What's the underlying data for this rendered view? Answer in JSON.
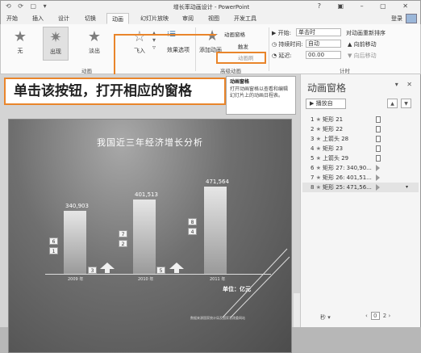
{
  "window": {
    "title": "增长率动画设计 - PowerPoint",
    "qat": "⟲ ⟳ ▢ ▾",
    "controls": "? ▣ – ▢ ✕"
  },
  "tabs": [
    "开始",
    "插入",
    "设计",
    "切换",
    "动画",
    "幻灯片放映",
    "审阅",
    "视图",
    "开发工具"
  ],
  "active_tab": "动画",
  "login": "登录",
  "ribbon": {
    "effects": [
      "无",
      "出现",
      "淡出",
      "飞入"
    ],
    "effect_options": "效果选项",
    "group_animation": "动画",
    "add_animation": "添加动画",
    "animation_pane": "动画窗格",
    "trigger": "触发",
    "animation_painter": "动画刷",
    "group_advanced": "高级动画",
    "start_label": "▶ 开始:",
    "start_value": "单击时",
    "duration_label": "◷ 持续时间:",
    "duration_value": "自动",
    "delay_label": "◔ 延迟:",
    "delay_value": "00.00",
    "reorder_title": "对动画重新排序",
    "move_earlier": "▲ 向前移动",
    "move_later": "▼ 向后移动",
    "group_timing": "计时"
  },
  "callout": "单击该按钮，打开相应的窗格",
  "tooltip": {
    "title": "动画窗格",
    "body": "打开动画窗格以查看和编辑幻灯片上的动画日程表。"
  },
  "slide": {
    "title": "我国近三年经济增长分析",
    "years": [
      "2009 年",
      "2010 年",
      "2011 年"
    ],
    "unit": "单位：亿元",
    "footnote": "数据来源国家统计局及国家发改委网站"
  },
  "chart_data": {
    "type": "bar",
    "categories": [
      "2009 年",
      "2010 年",
      "2011 年"
    ],
    "values": [
      340903,
      401513,
      471564
    ],
    "data_labels": [
      "340,903",
      "401,513",
      "471,564"
    ],
    "ylabel": "单位：亿元",
    "ylim": [
      0,
      600000
    ]
  },
  "pane": {
    "title": "动画窗格",
    "controls": "▾ ✕",
    "play": "▶ 播放自",
    "up": "▲",
    "down": "▼",
    "items": [
      {
        "n": "1",
        "label": "矩形 21",
        "tl": "box"
      },
      {
        "n": "2",
        "label": "矩形 22",
        "tl": "box"
      },
      {
        "n": "3",
        "label": "上箭头 28",
        "tl": "box"
      },
      {
        "n": "4",
        "label": "矩形 23",
        "tl": "box"
      },
      {
        "n": "5",
        "label": "上箭头 29",
        "tl": "box"
      },
      {
        "n": "6",
        "label": "矩形 27: 340,90...",
        "tl": "tri"
      },
      {
        "n": "7",
        "label": "矩形 26: 401,51...",
        "tl": "tri"
      },
      {
        "n": "8",
        "label": "矩形 25: 471,56...",
        "tl": "tri",
        "selected": true
      }
    ],
    "seconds": "秒 ▾",
    "page_prev": "‹",
    "page_start": "0",
    "page_end": "2",
    "page_next": "›"
  },
  "badges": [
    "6",
    "1",
    "3",
    "7",
    "2",
    "5",
    "8",
    "4"
  ]
}
